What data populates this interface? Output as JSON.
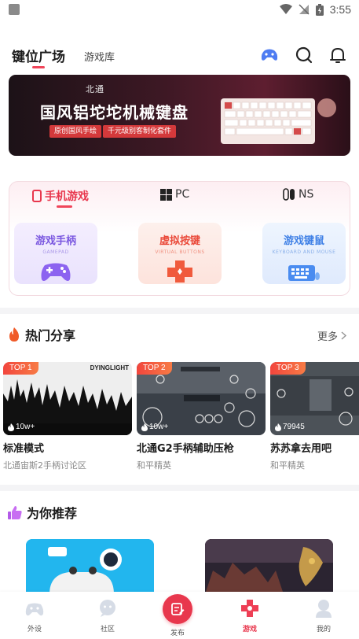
{
  "status_bar": {
    "time": "3:55"
  },
  "header": {
    "tab_active": "键位广场",
    "tab_inactive": "游戏库",
    "icons": [
      "gamepad-icon",
      "search-icon",
      "bell-icon"
    ]
  },
  "banner": {
    "brand": "北通",
    "title": "国风铝坨坨机械键盘",
    "tag1": "原创国风手绘",
    "tag2": "千元级别客制化套件"
  },
  "categories": {
    "tabs": [
      {
        "label": "手机游戏",
        "icon": "phone-icon",
        "active": true
      },
      {
        "label": "PC",
        "icon": "windows-icon",
        "active": false
      },
      {
        "label": "NS",
        "icon": "switch-icon",
        "active": false
      }
    ],
    "tiles": [
      {
        "title": "游戏手柄",
        "subtitle": "GAMEPAD",
        "icon": "gamepad-icon"
      },
      {
        "title": "虚拟按键",
        "subtitle": "VIRTUAL BUTTONS",
        "icon": "dpad-icon"
      },
      {
        "title": "游戏键鼠",
        "subtitle": "KEYBOARD AND MOUSE",
        "icon": "keyboard-icon"
      }
    ]
  },
  "hot": {
    "title": "热门分享",
    "more": "更多",
    "cards": [
      {
        "rank": "TOP 1",
        "views": "10w+",
        "title": "标准模式",
        "subtitle": "北通宙斯2手柄讨论区",
        "overlay": "DYINGLIGHT"
      },
      {
        "rank": "TOP 2",
        "views": "10w+",
        "title": "北通G2手柄辅助压枪",
        "subtitle": "和平精英"
      },
      {
        "rank": "TOP 3",
        "views": "79945",
        "title": "苏苏拿去用吧",
        "subtitle": "和平精英"
      }
    ]
  },
  "recommend": {
    "title": "为你推荐"
  },
  "bottom_nav": {
    "items": [
      {
        "label": "外设",
        "icon": "controller-icon",
        "active": false
      },
      {
        "label": "社区",
        "icon": "community-icon",
        "active": false
      },
      {
        "label": "发布",
        "icon": "publish-icon",
        "active": false
      },
      {
        "label": "游戏",
        "icon": "game-cross-icon",
        "active": true
      },
      {
        "label": "我的",
        "icon": "profile-icon",
        "active": false
      }
    ]
  },
  "colors": {
    "accent": "#e8374d",
    "text": "#1a1a1a",
    "muted": "#888888"
  }
}
